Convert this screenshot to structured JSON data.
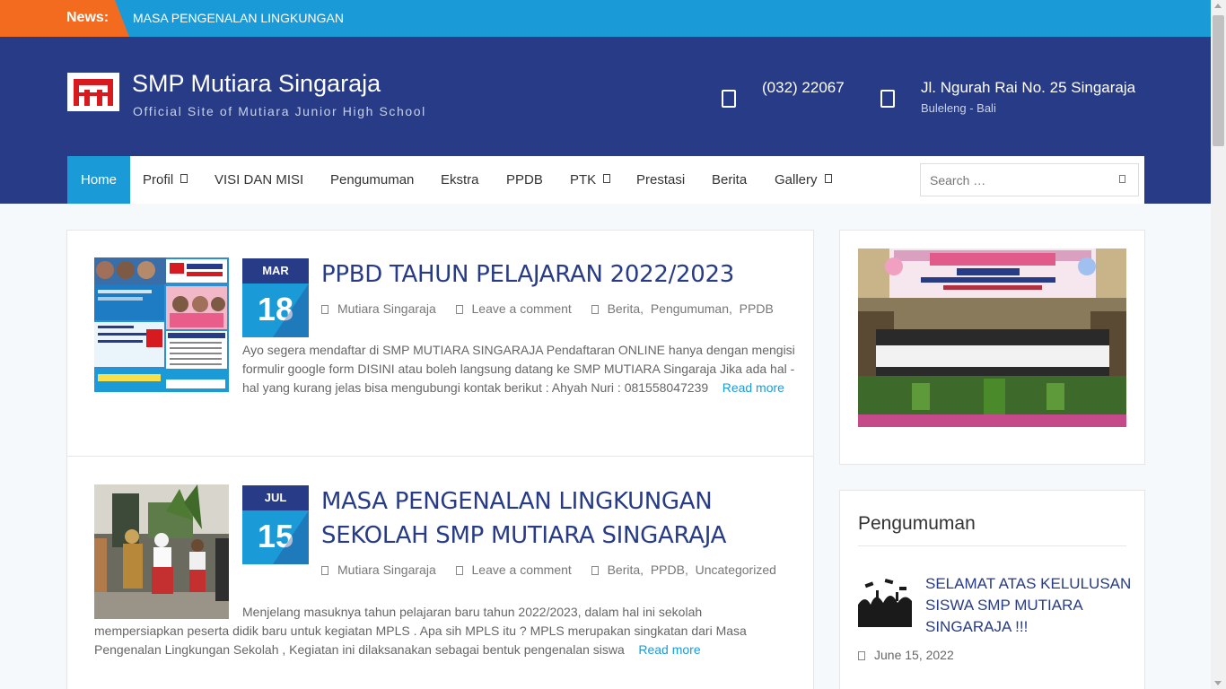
{
  "news": {
    "label": "News:",
    "text": "MASA PENGENALAN LINGKUNGAN"
  },
  "header": {
    "title": "SMP Mutiara Singaraja",
    "description": "Official Site of Mutiara Junior High School",
    "phone": "(032) 22067",
    "address_line1": "Jl. Ngurah Rai No. 25 Singaraja",
    "address_line2": "Buleleng - Bali"
  },
  "nav": {
    "items": [
      {
        "label": "Home"
      },
      {
        "label": "Profil"
      },
      {
        "label": "VISI DAN MISI"
      },
      {
        "label": "Pengumuman"
      },
      {
        "label": "Ekstra"
      },
      {
        "label": "PPDB"
      },
      {
        "label": "PTK"
      },
      {
        "label": "Prestasi"
      },
      {
        "label": "Berita"
      },
      {
        "label": "Gallery"
      }
    ],
    "search_placeholder": "Search …"
  },
  "posts": [
    {
      "month": "MAR",
      "day": "18",
      "title": "PPBD TAHUN PELAJARAN 2022/2023",
      "author": "Mutiara Singaraja",
      "comment": "Leave a comment",
      "categories": "Berita,  Pengumuman,  PPDB",
      "excerpt": "Ayo segera mendaftar di SMP MUTIARA SINGARAJA Pendaftaran ONLINE hanya dengan mengisi formulir google form DISINI atau boleh langsung datang ke SMP MUTIARA Singaraja Jika ada hal -hal yang kurang jelas bisa mengubungi kontak berikut : Ahyah Nuri : 081558047239",
      "read_more": "Read more"
    },
    {
      "month": "JUL",
      "day": "15",
      "title": "MASA PENGENALAN LINGKUNGAN SEKOLAH SMP MUTIARA SINGARAJA",
      "author": "Mutiara Singaraja",
      "comment": "Leave a comment",
      "categories": "Berita,  PPDB,  Uncategorized",
      "excerpt": "Menjelang masuknya tahun pelajaran baru tahun 2022/2023, dalam hal ini sekolah mempersiapkan peserta didik baru untuk kegiatan MPLS . Apa sih MPLS itu ? MPLS merupakan singkatan dari Masa Pengenalan Lingkungan Sekolah , Kegiatan ini dilaksanakan sebagai bentuk pengenalan siswa",
      "read_more": "Read more"
    }
  ],
  "sidebar": {
    "announcement_title": "Pengumuman",
    "announcement_item": "SELAMAT ATAS KELULUSAN SISWA SMP MUTIARA SINGARAJA !!!",
    "announcement_date": "June 15, 2022"
  },
  "colors": {
    "primary": "#1a9bd8",
    "dark": "#273b86",
    "news_label": "#f26b1f"
  }
}
